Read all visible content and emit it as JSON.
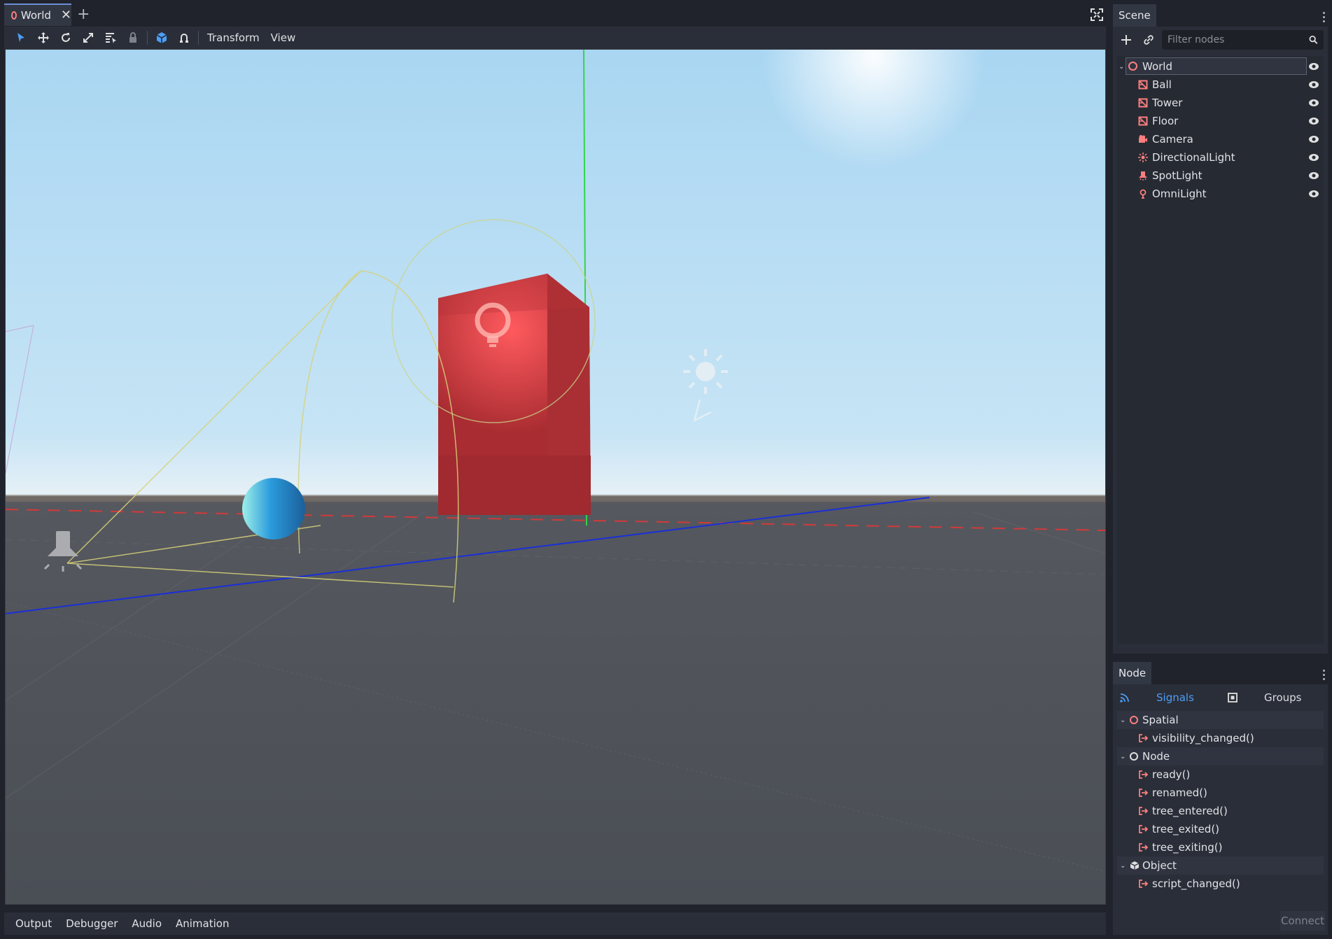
{
  "editor_tab": {
    "title": "World"
  },
  "toolbar": {
    "transform_menu": "Transform",
    "view_menu": "View"
  },
  "bottom_panel": {
    "tabs": [
      "Output",
      "Debugger",
      "Audio",
      "Animation"
    ]
  },
  "scene_dock": {
    "title": "Scene",
    "filter_placeholder": "Filter nodes",
    "nodes": [
      {
        "label": "World",
        "icon": "spatial-icon",
        "root": true
      },
      {
        "label": "Ball",
        "icon": "mesh-instance-icon"
      },
      {
        "label": "Tower",
        "icon": "mesh-instance-icon"
      },
      {
        "label": "Floor",
        "icon": "mesh-instance-icon"
      },
      {
        "label": "Camera",
        "icon": "camera-icon"
      },
      {
        "label": "DirectionalLight",
        "icon": "directional-light-icon"
      },
      {
        "label": "SpotLight",
        "icon": "spot-light-icon"
      },
      {
        "label": "OmniLight",
        "icon": "omni-light-icon"
      }
    ]
  },
  "node_dock": {
    "title": "Node",
    "signals_tab": "Signals",
    "groups_tab": "Groups",
    "sections": [
      {
        "label": "Spatial",
        "signals": [
          "visibility_changed()"
        ]
      },
      {
        "label": "Node",
        "signals": [
          "ready()",
          "renamed()",
          "tree_entered()",
          "tree_exited()",
          "tree_exiting()"
        ]
      },
      {
        "label": "Object",
        "signals": [
          "script_changed()"
        ]
      }
    ],
    "connect_label": "Connect"
  },
  "colors": {
    "accent": "#6c8fd6",
    "node_icon": "#fc7f7f",
    "active_tab": "#4d9ef5"
  }
}
